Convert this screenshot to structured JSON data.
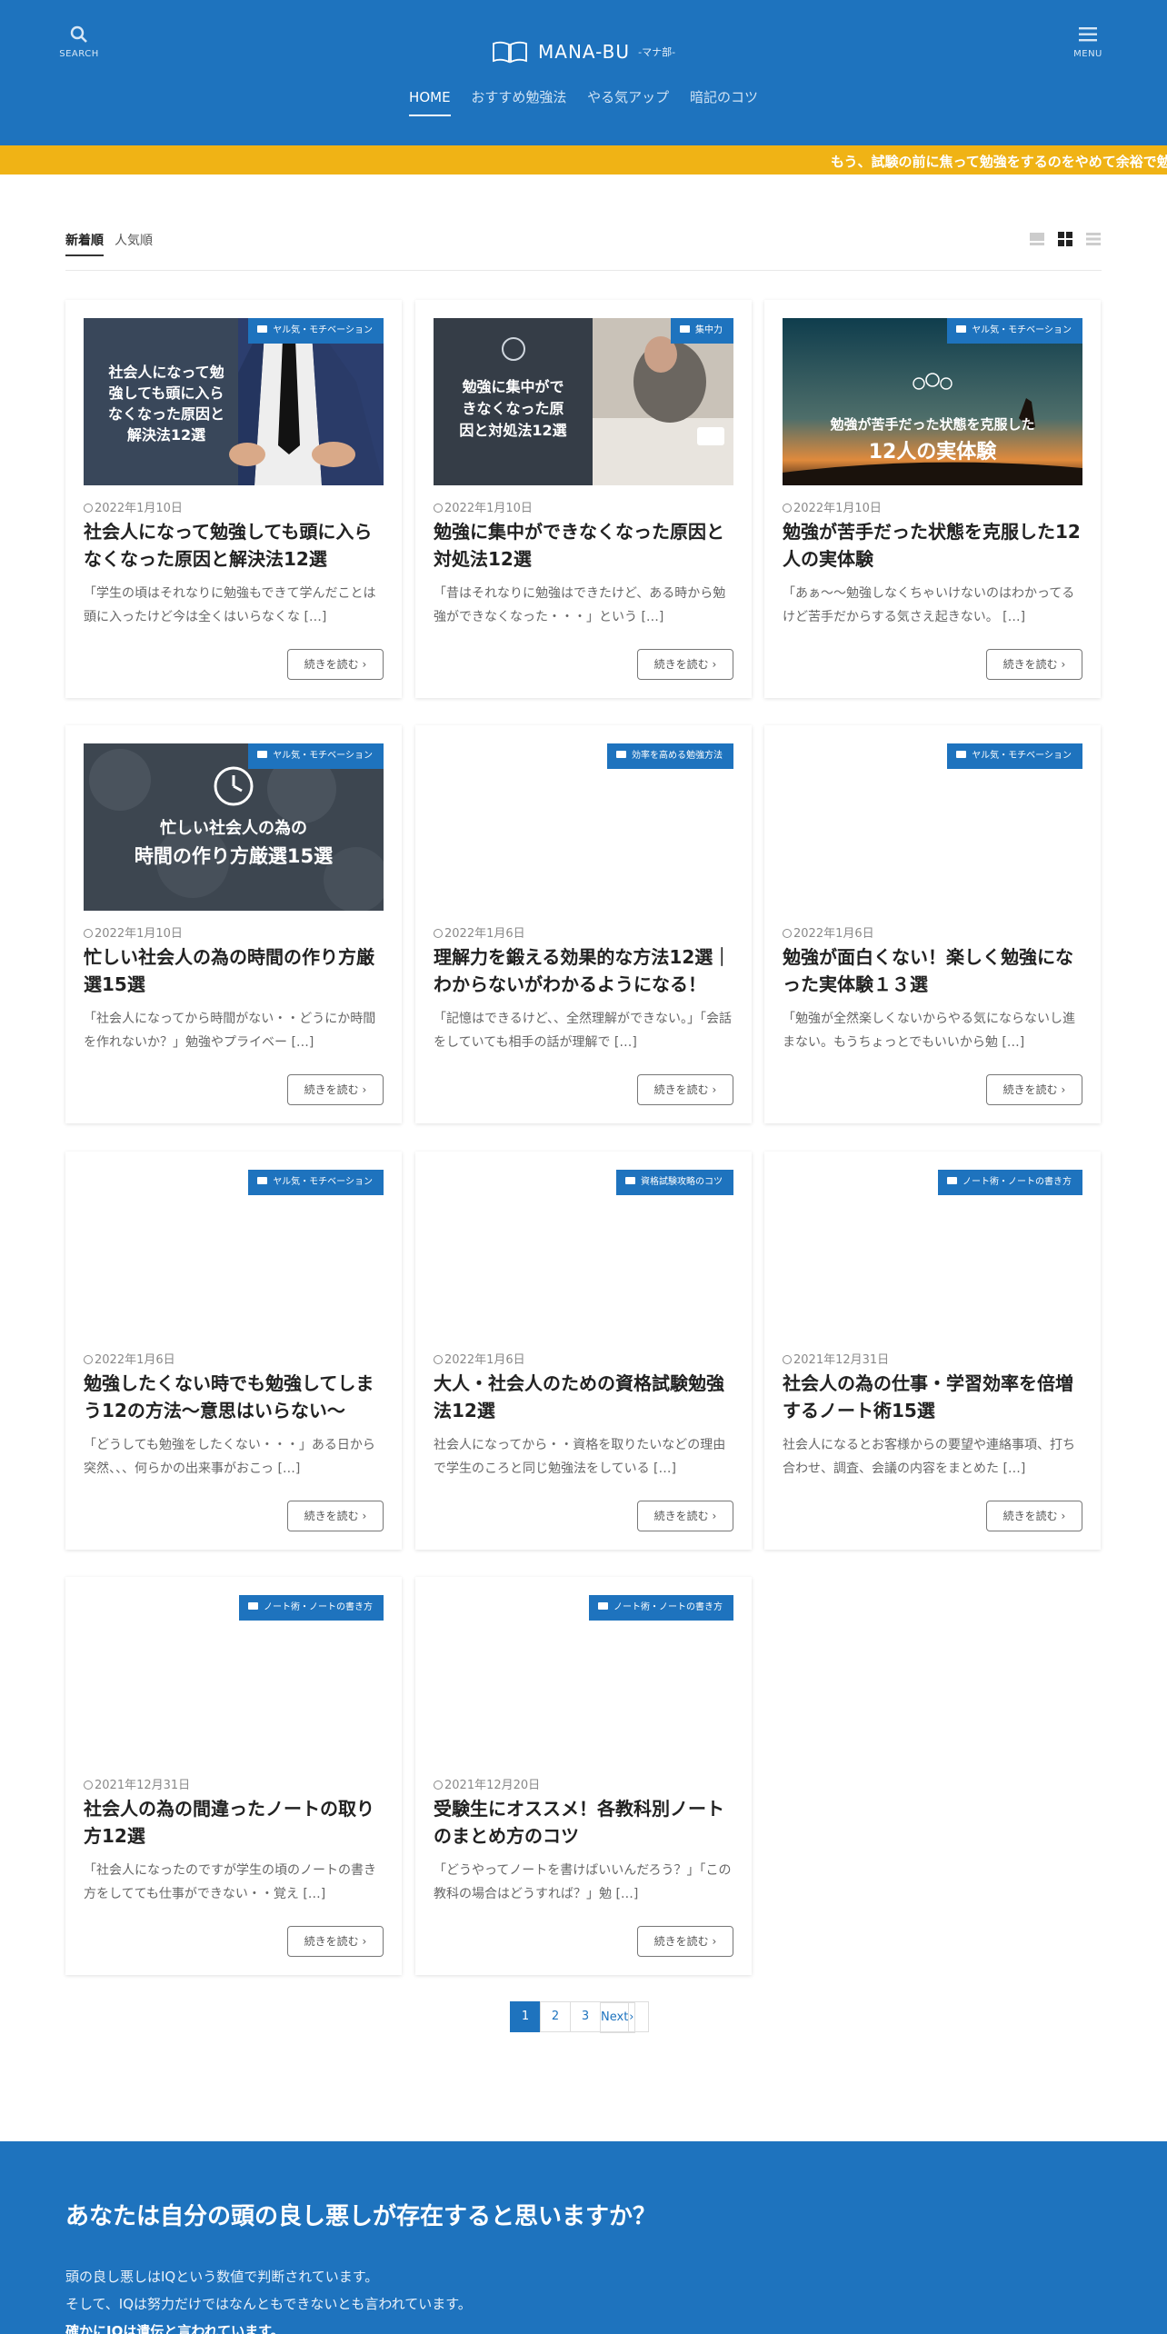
{
  "header": {
    "search_label": "SEARCH",
    "menu_label": "MENU",
    "logo_text": "MANA-BU",
    "logo_sub": "-マナ部-",
    "nav": [
      "HOME",
      "おすすめ勉強法",
      "やる気アップ",
      "暗記のコツ"
    ]
  },
  "ticker": "もう、試験の前に焦って勉強をするのをやめて余裕で勉",
  "sort": {
    "new": "新着順",
    "popular": "人気順"
  },
  "more_label": "続きを読む",
  "cards": [
    {
      "category": "ヤル気・モチベーション",
      "date": "2022年1月10日",
      "title": "社会人になって勉強しても頭に入らなくなった原因と解決法12選",
      "excerpt": "「学生の頃はそれなりに勉強もできて学んだことは頭に入ったけど今は全くはいらなくな […]",
      "thumb_text": [
        "社会人になって勉",
        "強しても頭に入ら",
        "なくなった原因と",
        "解決法12選"
      ]
    },
    {
      "category": "集中力",
      "date": "2022年1月10日",
      "title": "勉強に集中ができなくなった原因と対処法12選",
      "excerpt": "「昔はそれなりに勉強はできたけど、ある時から勉強ができなくなった・・・」という […]",
      "thumb_text": [
        "勉強に集中がで",
        "きなくなった原",
        "因と対処法12選"
      ]
    },
    {
      "category": "ヤル気・モチベーション",
      "date": "2022年1月10日",
      "title": "勉強が苦手だった状態を克服した12人の実体験",
      "excerpt": "「あぁ～～勉強しなくちゃいけないのはわかってるけど苦手だからする気さえ起きない。 […]",
      "thumb_text": [
        "勉強が苦手だった状態を克服した",
        "12人の実体験"
      ]
    },
    {
      "category": "ヤル気・モチベーション",
      "date": "2022年1月10日",
      "title": "忙しい社会人の為の時間の作り方厳選15選",
      "excerpt": "「社会人になってから時間がない・・どうにか時間を作れないか？」勉強やプライベー […]",
      "thumb_text": [
        "忙しい社会人の為の",
        "時間の作り方厳選15選"
      ]
    },
    {
      "category": "効率を高める勉強方法",
      "date": "2022年1月6日",
      "title": "理解力を鍛える効果的な方法12選｜わからないがわかるようになる！",
      "excerpt": "「記憶はできるけど、、全然理解ができない。」「会話をしていても相手の話が理解で […]"
    },
    {
      "category": "ヤル気・モチベーション",
      "date": "2022年1月6日",
      "title": "勉強が面白くない！楽しく勉強になった実体験１３選",
      "excerpt": "「勉強が全然楽しくないからやる気にならないし進まない。もうちょっとでもいいから勉 […]"
    },
    {
      "category": "ヤル気・モチベーション",
      "date": "2022年1月6日",
      "title": "勉強したくない時でも勉強してしまう12の方法～意思はいらない～",
      "excerpt": "「どうしても勉強をしたくない・・・」ある日から突然、、、何らかの出来事がおこっ […]"
    },
    {
      "category": "資格試験攻略のコツ",
      "date": "2022年1月6日",
      "title": "大人・社会人のための資格試験勉強法12選",
      "excerpt": "社会人になってから・・資格を取りたいなどの理由で学生のころと同じ勉強法をしている […]"
    },
    {
      "category": "ノート術・ノートの書き方",
      "date": "2021年12月31日",
      "title": "社会人の為の仕事・学習効率を倍増するノート術15選",
      "excerpt": "社会人になるとお客様からの要望や連絡事項、打ち合わせ、調査、会議の内容をまとめた […]"
    },
    {
      "category": "ノート術・ノートの書き方",
      "date": "2021年12月31日",
      "title": "社会人の為の間違ったノートの取り方12選",
      "excerpt": "「社会人になったのですが学生の頃のノートの書き方をしてても仕事ができない・・覚え […]"
    },
    {
      "category": "ノート術・ノートの書き方",
      "date": "2021年12月20日",
      "title": "受験生にオススメ！各教科別ノートのまとめ方のコツ",
      "excerpt": "「どうやってノートを書けばいいんだろう？」「この教科の場合はどうすれば？」勉 […]"
    }
  ],
  "pager": {
    "pages": [
      "1",
      "2",
      "3"
    ],
    "next": "Next"
  },
  "about": {
    "heading": "あなたは自分の頭の良し悪しが存在すると思いますか？",
    "lines": [
      "頭の良し悪しはIQという数値で判断されています。",
      "そして、IQは努力だけではなんともできないとも言われています。",
      "確かにIQは遺伝と言われています。"
    ]
  }
}
